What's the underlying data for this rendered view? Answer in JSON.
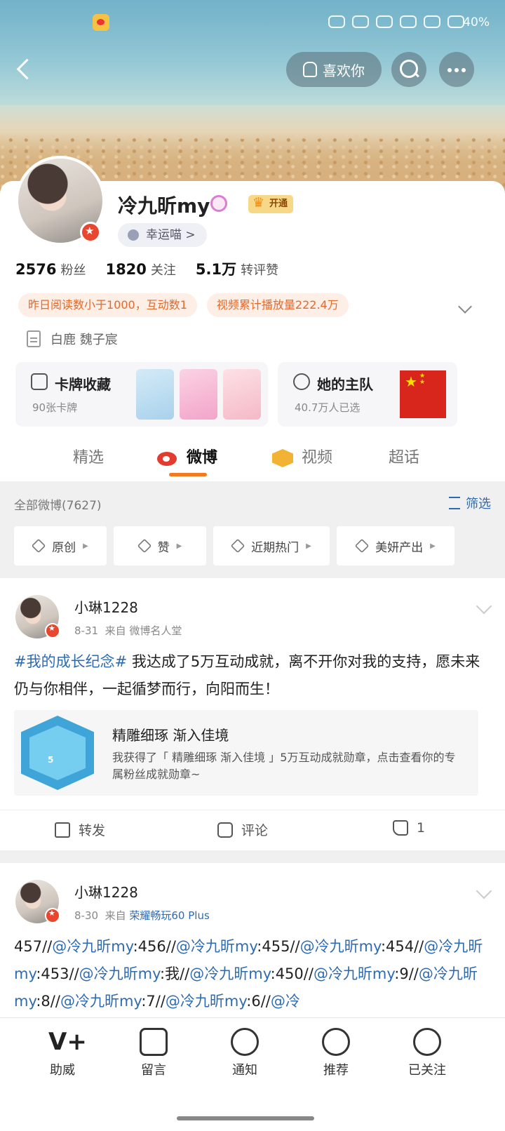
{
  "status": {
    "battery": "40%"
  },
  "header": {
    "like_label": "喜欢你"
  },
  "profile": {
    "name": "冷九昕my",
    "vip_label": "开通",
    "lucky_tag": "幸运喵 >",
    "stats": [
      {
        "num": "2576",
        "label": "粉丝"
      },
      {
        "num": "1820",
        "label": "关注"
      },
      {
        "num": "5.1万",
        "label": "转评赞"
      }
    ],
    "tags": [
      "昨日阅读数小于1000，互动数1",
      "视频累计播放量222.4万"
    ],
    "bio": "白鹿 魏子宸",
    "cards": {
      "collect": {
        "title": "卡牌收藏",
        "sub": "90张卡牌"
      },
      "team": {
        "title": "她的主队",
        "sub": "40.7万人已选"
      }
    }
  },
  "tabs": [
    "精选",
    "微博",
    "视频",
    "超话"
  ],
  "filter": {
    "all_count": "全部微博(7627)",
    "filter_label": "筛选",
    "chips": [
      "原创",
      "赞",
      "近期热门",
      "美妍产出"
    ]
  },
  "posts": [
    {
      "name": "小琳1228",
      "date": "8-31",
      "source_prefix": "来自",
      "source": "微博名人堂",
      "topic": "#我的成长纪念#",
      "text": " 我达成了5万互动成就，离不开你对我的支持，愿未来仍与你相伴，一起循梦而行，向阳而生！",
      "embed_title": "精雕细琢 渐入佳境",
      "embed_desc": "我获得了「 精雕细琢 渐入佳境 」5万互动成就勋章，点击查看你的专属粉丝成就勋章~",
      "medal_num": "5",
      "actions": {
        "repost": "转发",
        "comment": "评论",
        "like_count": "1"
      }
    },
    {
      "name": "小琳1228",
      "date": "8-30",
      "source_prefix": "来自",
      "source": "荣耀畅玩60 Plus",
      "text_parts": [
        {
          "t": "457//",
          "m": false
        },
        {
          "t": "@冷九昕my",
          "m": true
        },
        {
          "t": ":456//",
          "m": false
        },
        {
          "t": "@冷九昕my",
          "m": true
        },
        {
          "t": ":455//",
          "m": false
        },
        {
          "t": "@冷九昕my",
          "m": true
        },
        {
          "t": ":454//",
          "m": false
        },
        {
          "t": "@冷九昕my",
          "m": true
        },
        {
          "t": ":453//",
          "m": false
        },
        {
          "t": "@冷九昕my",
          "m": true
        },
        {
          "t": ":我//",
          "m": false
        },
        {
          "t": "@冷九昕my",
          "m": true
        },
        {
          "t": ":450//",
          "m": false
        },
        {
          "t": "@冷九昕my",
          "m": true
        },
        {
          "t": ":9//",
          "m": false
        },
        {
          "t": "@冷九昕my",
          "m": true
        },
        {
          "t": ":8//",
          "m": false
        },
        {
          "t": "@冷九昕my",
          "m": true
        },
        {
          "t": ":7//",
          "m": false
        },
        {
          "t": "@冷九昕my",
          "m": true
        },
        {
          "t": ":6//",
          "m": false
        },
        {
          "t": "@冷",
          "m": true
        }
      ]
    }
  ],
  "bottom_bar": [
    "助威",
    "留言",
    "通知",
    "推荐",
    "已关注"
  ],
  "colors": {
    "accent": "#f47a1f",
    "link": "#2e6bb3",
    "badge": "#e8462f"
  }
}
